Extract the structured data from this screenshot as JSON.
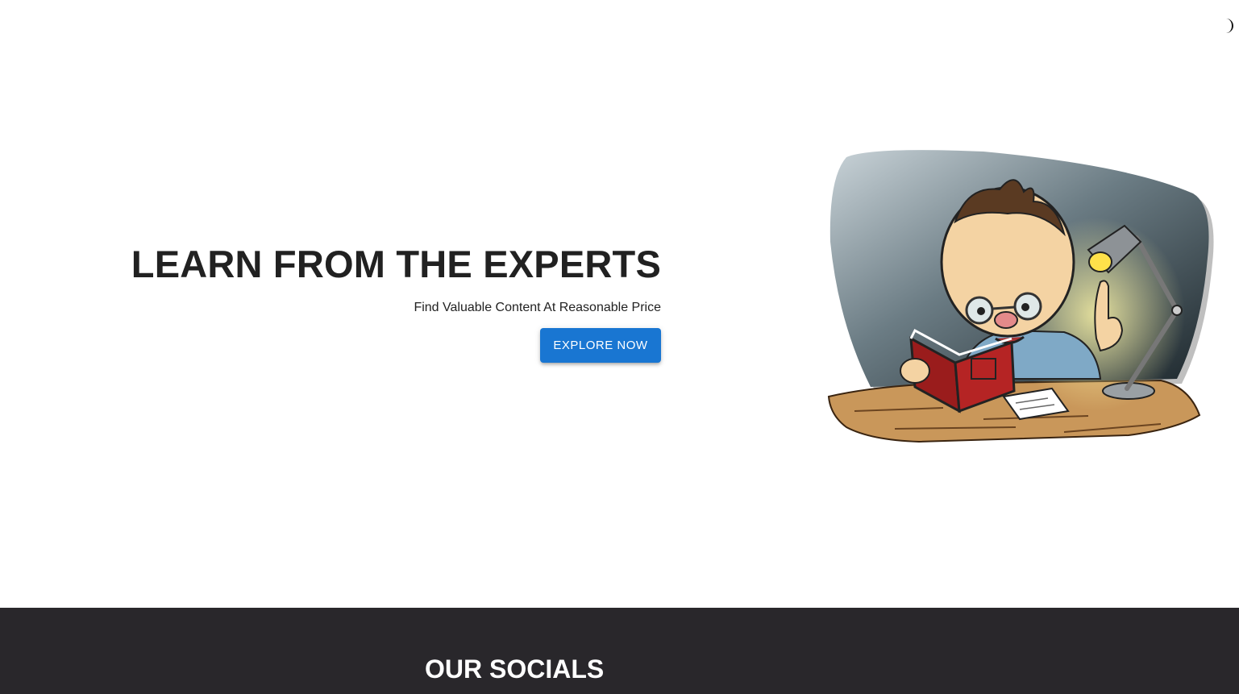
{
  "theme_toggle": {
    "icon": "moon-icon"
  },
  "hero": {
    "title": "LEARN FROM THE EXPERTS",
    "subtitle": "Find Valuable Content At Reasonable Price",
    "button_label": "EXPLORE NOW",
    "illustration": "professor-reading-book-illustration"
  },
  "footer": {
    "title": "OUR SOCIALS"
  },
  "colors": {
    "accent": "#1976d2",
    "footer_bg": "#29272b",
    "heading": "#212121"
  }
}
